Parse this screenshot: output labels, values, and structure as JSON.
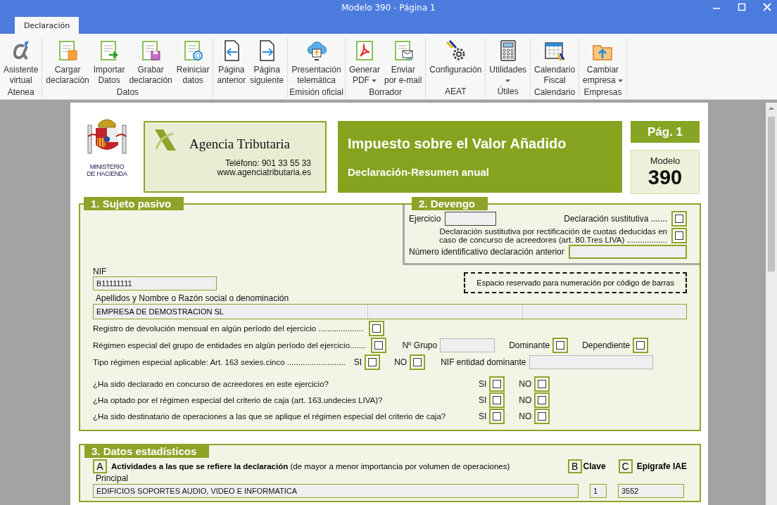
{
  "window": {
    "title": "Modelo 390 - Página 1"
  },
  "tabs": [
    {
      "label": "Declaración",
      "selected": true
    }
  ],
  "ribbon": {
    "groups": [
      {
        "label": "Atenea",
        "buttons": [
          {
            "lines": [
              "Asistente",
              "virtual"
            ],
            "dropdown": false
          }
        ]
      },
      {
        "label": "Datos",
        "buttons": [
          {
            "lines": [
              "Cargar",
              "declaración"
            ],
            "dropdown": false
          },
          {
            "lines": [
              "Importar",
              "Datos"
            ],
            "dropdown": false
          },
          {
            "lines": [
              "Grabar",
              "declaración"
            ],
            "dropdown": false
          },
          {
            "lines": [
              "Reiniciar",
              "datos"
            ],
            "dropdown": false
          }
        ]
      },
      {
        "buttons": [
          {
            "lines": [
              "Página",
              "anterior"
            ],
            "dropdown": false
          },
          {
            "lines": [
              "Página",
              "siguiente"
            ],
            "dropdown": false
          }
        ]
      },
      {
        "label": "Emisión oficial",
        "buttons": [
          {
            "lines": [
              "Presentación",
              "telemática"
            ],
            "dropdown": false
          }
        ]
      },
      {
        "label": "Borrador",
        "buttons": [
          {
            "lines": [
              "Generar",
              "PDF"
            ],
            "dropdown": true
          },
          {
            "lines": [
              "Enviar",
              "por e-mail"
            ],
            "dropdown": false
          }
        ]
      },
      {
        "label": "AEAT",
        "buttons": [
          {
            "lines": [
              "Configuración"
            ],
            "dropdown": false
          }
        ]
      },
      {
        "label": "Útiles",
        "buttons": [
          {
            "lines": [
              "Utilidades"
            ],
            "dropdown": true
          }
        ]
      },
      {
        "label": "Calendario",
        "buttons": [
          {
            "lines": [
              "Calendario",
              "Fiscal"
            ],
            "dropdown": false
          }
        ]
      },
      {
        "label": "Empresas",
        "buttons": [
          {
            "lines": [
              "Cambiar",
              "empresa"
            ],
            "dropdown": true
          }
        ]
      }
    ]
  },
  "header": {
    "ministry": [
      "MINISTERIO",
      "DE HACIENDA"
    ],
    "agency": "Agencia Tributaria",
    "phone": "Teléfono: 901 33 55 33",
    "web": "www.agenciatributaria.es",
    "title": "Impuesto sobre el Valor Añadido",
    "subtitle": "Declaración-Resumen anual",
    "page": "Pág. 1",
    "model_label": "Modelo",
    "model": "390"
  },
  "section1": {
    "title": "1. Sujeto pasivo",
    "nif_label": "NIF",
    "nif": "B11111111",
    "barcode_note": "Espacio reservado para numeración por código de barras",
    "name_label": "Apellidos y Nombre o Razón social o denominación",
    "name": "EMPRESA DE DEMOSTRACION SL",
    "refund": {
      "label": "Registro de devolución mensual en algún período del ejercicio ....................",
      "checked": false
    },
    "group_regime": {
      "label": "Régimen especial del grupo de entidades en algún período del ejercicio.......",
      "checked": false
    },
    "group_no_label": "Nº Grupo",
    "dominant": {
      "label": "Dominante",
      "checked": false
    },
    "dependent": {
      "label": "Dependiente",
      "checked": false
    },
    "regime_type": {
      "label": "Tipo régimen especial aplicable: Art. 163 sexies.cinco ..........................",
      "yes": {
        "label": "SI",
        "checked": false
      },
      "no": {
        "label": "NO",
        "checked": false
      }
    },
    "dominant_nif_label": "NIF entidad dominante",
    "questions": [
      {
        "text": "¿Ha sido declarado en concurso de acreedores en este ejercicio?",
        "yes": {
          "label": "SI",
          "checked": false
        },
        "no": {
          "label": "NO",
          "checked": false
        }
      },
      {
        "text": "¿Ha optado por el régimen especial del criterio de caja (art. 163.undecies LIVA)?",
        "yes": {
          "label": "SI",
          "checked": false
        },
        "no": {
          "label": "NO",
          "checked": false
        }
      },
      {
        "text": "¿Ha sido destinatario de operaciones a las que se aplique el régimen especial del criterio de caja?",
        "yes": {
          "label": "SI",
          "checked": false
        },
        "no": {
          "label": "NO",
          "checked": false
        }
      }
    ]
  },
  "section2": {
    "title": "2. Devengo",
    "year_label": "Ejercicio",
    "substitute": {
      "label": "Declaración sustitutiva .......",
      "checked": false
    },
    "substitute_rect": {
      "label": "Declaración sustitutiva por rectificación de cuotas deducidas en caso de concurso de acreedores (art. 80.Tres LIVA) ..................",
      "checked": false
    },
    "previous_label": "Número identificativo declaración anterior"
  },
  "section3": {
    "title": "3. Datos estadísticos",
    "a_letter": "A",
    "a_text": "**Actividades a las que se refiere la declaración** (de mayor a menor importancia por volumen de operaciones)",
    "b_letter": "B",
    "b_label": "Clave",
    "c_letter": "C",
    "c_label": "Epígrafe IAE",
    "principal_label": "Principal",
    "activity": "EDIFICIOS SOPORTES AUDIO, VIDEO E INFORMATICA",
    "key": "1",
    "epigraph": "3552"
  }
}
